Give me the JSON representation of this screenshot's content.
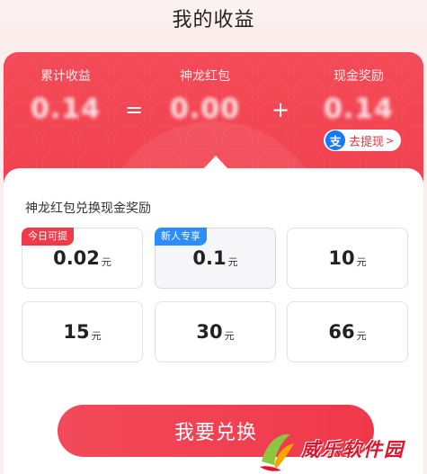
{
  "header": {
    "title": "我的收益"
  },
  "summary": {
    "total_label": "累计收益",
    "total_value": "0.14",
    "equals": "=",
    "dragon_label": "神龙红包",
    "dragon_value": "0.00",
    "plus": "+",
    "cash_label": "现金奖励",
    "cash_value": "0.14",
    "withdraw": {
      "icon": "alipay-icon",
      "icon_glyph": "支",
      "label": "去提现",
      "chevron": ">"
    }
  },
  "exchange": {
    "title": "神龙红包兑换现金奖励",
    "unit": "元",
    "options": [
      {
        "amount": "0.02",
        "tag": "今日可提",
        "tag_color": "#f03a4a"
      },
      {
        "amount": "0.1",
        "tag": "新人专享",
        "tag_color": "#2d8cff",
        "selected": true
      },
      {
        "amount": "10"
      },
      {
        "amount": "15"
      },
      {
        "amount": "30"
      },
      {
        "amount": "66"
      }
    ],
    "button_label": "我要兑换"
  },
  "watermark": {
    "text": "威乐软件园"
  },
  "colors": {
    "accent": "#f0404e",
    "blue_tag": "#2d8cff",
    "alipay": "#1677ff"
  }
}
